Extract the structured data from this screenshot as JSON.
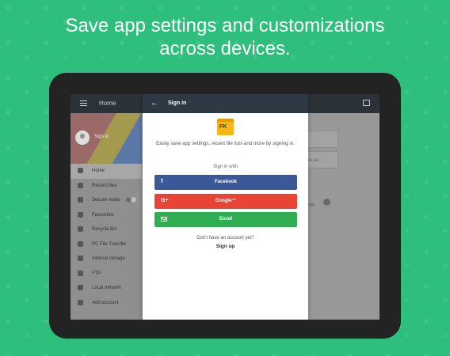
{
  "headline": {
    "line1": "Save app settings and customizations",
    "line2": "across devices."
  },
  "app": {
    "toolbar_title": "Home",
    "drawer_signin": "Sign in",
    "drawer_items": [
      {
        "label": "Home",
        "icon": "home-icon",
        "active": true
      },
      {
        "label": "Recent files",
        "icon": "history-icon"
      },
      {
        "label": "Secure mode",
        "icon": "shield-icon",
        "toggle": true
      },
      {
        "label": "Favourites",
        "icon": "star-icon"
      },
      {
        "label": "Recycle Bin",
        "icon": "trash-icon"
      },
      {
        "label": "PC File Transfer",
        "icon": "pc-icon"
      },
      {
        "label": "Internal storage",
        "icon": "storage-icon"
      },
      {
        "label": "FTP",
        "icon": "globe-icon"
      },
      {
        "label": "Local network",
        "icon": "network-icon"
      },
      {
        "label": "Add account",
        "icon": "add-account-icon"
      }
    ],
    "bg_card_text_1": "ts Lib",
    "bg_card_text_2": "app"
  },
  "signin_panel": {
    "title": "Sign in",
    "logo_text": "FK",
    "description": "Easily save app settings, recent file lists and more by signing in.",
    "signin_with": "Sign in with",
    "facebook_label": "Facebook",
    "facebook_icon": "f",
    "google_label": "Google™",
    "google_icon": "G+",
    "email_label": "Email",
    "no_account": "Don't have an account yet?",
    "sign_up": "Sign up"
  },
  "colors": {
    "background": "#2fbf7d",
    "facebook": "#3b5998",
    "google": "#e94335",
    "email": "#2fae52",
    "toolbar": "#2e3a43"
  }
}
